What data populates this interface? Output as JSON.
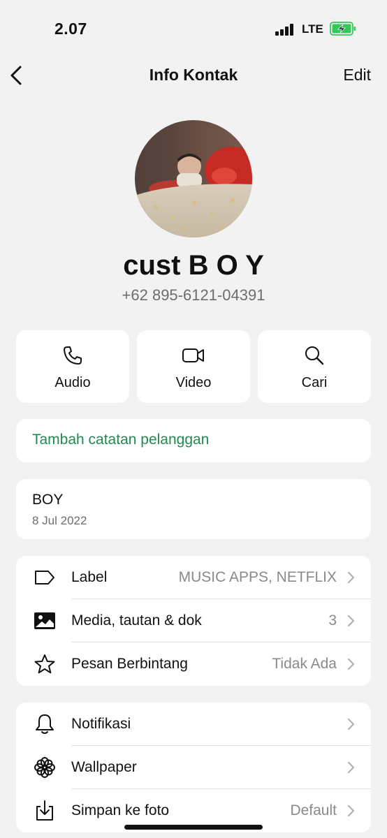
{
  "status": {
    "time": "2.07",
    "network": "LTE"
  },
  "nav": {
    "title": "Info Kontak",
    "edit": "Edit"
  },
  "contact": {
    "name": "cust B O Y",
    "phone": "+62 895-6121-04391"
  },
  "actions": [
    {
      "label": "Audio",
      "icon": "phone-icon"
    },
    {
      "label": "Video",
      "icon": "video-icon"
    },
    {
      "label": "Cari",
      "icon": "search-icon"
    }
  ],
  "note": {
    "label": "Tambah catatan pelanggan",
    "color": "#1f8a53"
  },
  "about": {
    "text": "BOY",
    "date": "8 Jul 2022"
  },
  "list1": [
    {
      "label": "Label",
      "value": "MUSIC APPS, NETFLIX",
      "icon": "tag-icon"
    },
    {
      "label": "Media, tautan & dok",
      "value": "3",
      "icon": "image-icon"
    },
    {
      "label": "Pesan Berbintang",
      "value": "Tidak Ada",
      "icon": "star-icon"
    }
  ],
  "list2": [
    {
      "label": "Notifikasi",
      "value": "",
      "icon": "bell-icon"
    },
    {
      "label": "Wallpaper",
      "value": "",
      "icon": "flower-icon"
    },
    {
      "label": "Simpan ke foto",
      "value": "Default",
      "icon": "download-icon"
    }
  ],
  "colors": {
    "accent": "#1f8a53",
    "battery": "#34c759",
    "background": "#f2f2f2"
  }
}
